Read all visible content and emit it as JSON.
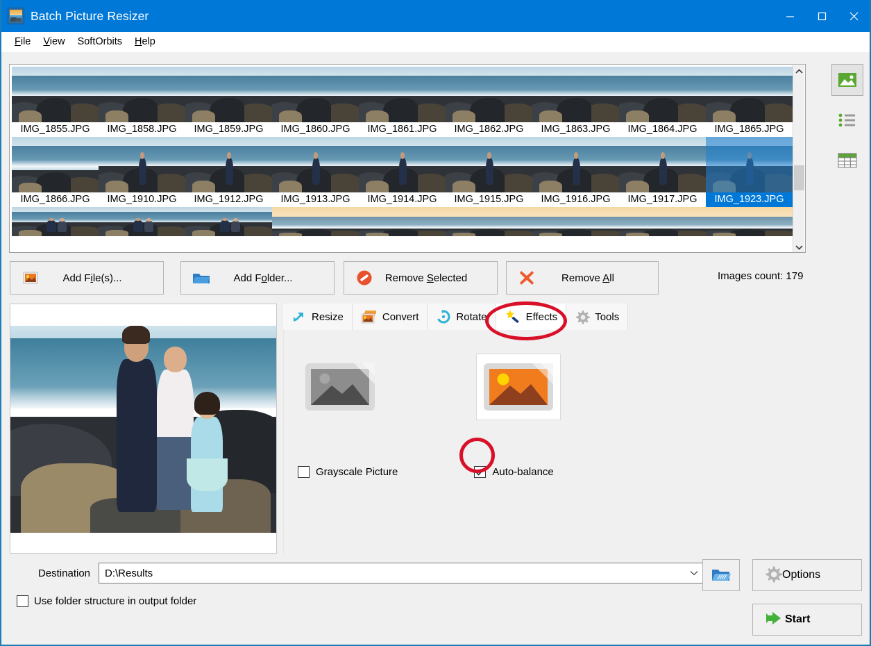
{
  "window": {
    "title": "Batch Picture Resizer",
    "app_icon": "picture-icon",
    "titlebar_color": "#0078d7",
    "minimize": "–",
    "maximize": "□",
    "close": "✕"
  },
  "menu": {
    "items": [
      {
        "label": "File",
        "mnemonic": "F"
      },
      {
        "label": "View",
        "mnemonic": "V"
      },
      {
        "label": "SoftOrbits",
        "mnemonic": ""
      },
      {
        "label": "Help",
        "mnemonic": "H"
      }
    ]
  },
  "thumbnails": {
    "selected": "IMG_1923.JPG",
    "items": [
      {
        "name": "IMG_1855.JPG",
        "style": "rocks"
      },
      {
        "name": "IMG_1858.JPG",
        "style": "foam"
      },
      {
        "name": "IMG_1859.JPG",
        "style": "rocks"
      },
      {
        "name": "IMG_1860.JPG",
        "style": "wave"
      },
      {
        "name": "IMG_1861.JPG",
        "style": "wave"
      },
      {
        "name": "IMG_1862.JPG",
        "style": "rocks"
      },
      {
        "name": "IMG_1863.JPG",
        "style": "rocks"
      },
      {
        "name": "IMG_1864.JPG",
        "style": "foam"
      },
      {
        "name": "IMG_1865.JPG",
        "style": "foam"
      },
      {
        "name": "IMG_1866.JPG",
        "style": "open"
      },
      {
        "name": "IMG_1910.JPG",
        "style": "person"
      },
      {
        "name": "IMG_1912.JPG",
        "style": "person"
      },
      {
        "name": "IMG_1913.JPG",
        "style": "person"
      },
      {
        "name": "IMG_1914.JPG",
        "style": "person"
      },
      {
        "name": "IMG_1915.JPG",
        "style": "person"
      },
      {
        "name": "IMG_1916.JPG",
        "style": "person"
      },
      {
        "name": "IMG_1917.JPG",
        "style": "person"
      },
      {
        "name": "IMG_1923.JPG",
        "style": "family"
      }
    ],
    "partial_row": [
      {
        "style": "couple"
      },
      {
        "style": "couple"
      },
      {
        "style": "couple"
      },
      {
        "style": "sunset"
      },
      {
        "style": "sunset"
      },
      {
        "style": "sunset"
      },
      {
        "style": "sunset"
      },
      {
        "style": "sunset"
      },
      {
        "style": "sunset"
      }
    ],
    "scrollbar": {
      "up": "▲",
      "down": "▼"
    }
  },
  "view_modes": [
    {
      "name": "thumbnails-view",
      "icon": "picture-icon",
      "active": true
    },
    {
      "name": "list-view",
      "icon": "list-icon",
      "active": false
    },
    {
      "name": "details-view",
      "icon": "table-icon",
      "active": false
    }
  ],
  "actions": {
    "add_files": {
      "label_pre": "Add F",
      "mnemonic": "i",
      "label_post": "le(s)...",
      "icon": "add-picture-icon"
    },
    "add_folder": {
      "label_pre": "Add F",
      "mnemonic": "o",
      "label_post": "lder...",
      "icon": "folder-icon"
    },
    "remove_selected": {
      "label_pre": "Remove ",
      "mnemonic": "S",
      "label_post": "elected",
      "icon": "no-entry-icon"
    },
    "remove_all": {
      "label_pre": "Remove ",
      "mnemonic": "A",
      "label_post": "ll",
      "icon": "red-x-icon"
    },
    "images_count": "Images count: 179"
  },
  "tabs": [
    {
      "label": "Resize",
      "icon": "resize-arrows-icon",
      "active": false
    },
    {
      "label": "Convert",
      "icon": "convert-stack-icon",
      "active": false
    },
    {
      "label": "Rotate",
      "icon": "rotate-icon",
      "active": false
    },
    {
      "label": "Effects",
      "icon": "magic-wand-icon",
      "active": true
    },
    {
      "label": "Tools",
      "icon": "gear-icon",
      "active": false
    }
  ],
  "effects": {
    "grayscale_preview_icon": "grayscale-picture-icon",
    "autobalance_preview_icon": "color-picture-icon",
    "grayscale": {
      "label": "Grayscale Picture",
      "checked": false
    },
    "autobalance": {
      "label": "Auto-balance",
      "checked": true,
      "check_glyph": "✓"
    }
  },
  "destination": {
    "label": "Destination",
    "value": "D:\\Results",
    "placeholder": "D:\\Results",
    "dropdown_glyph": "⌄",
    "browse_icon": "open-folder-icon"
  },
  "folder_structure": {
    "label": "Use folder structure in output folder",
    "checked": false
  },
  "buttons": {
    "options": {
      "label": "Options",
      "icon": "gear-icon"
    },
    "start": {
      "label": "Start",
      "icon": "green-arrow-icon"
    }
  },
  "annotations": {
    "color": "#d81028",
    "effects_tab_circle": "highlight-effects-tab",
    "autobalance_circle": "highlight-autobalance-checkbox"
  }
}
